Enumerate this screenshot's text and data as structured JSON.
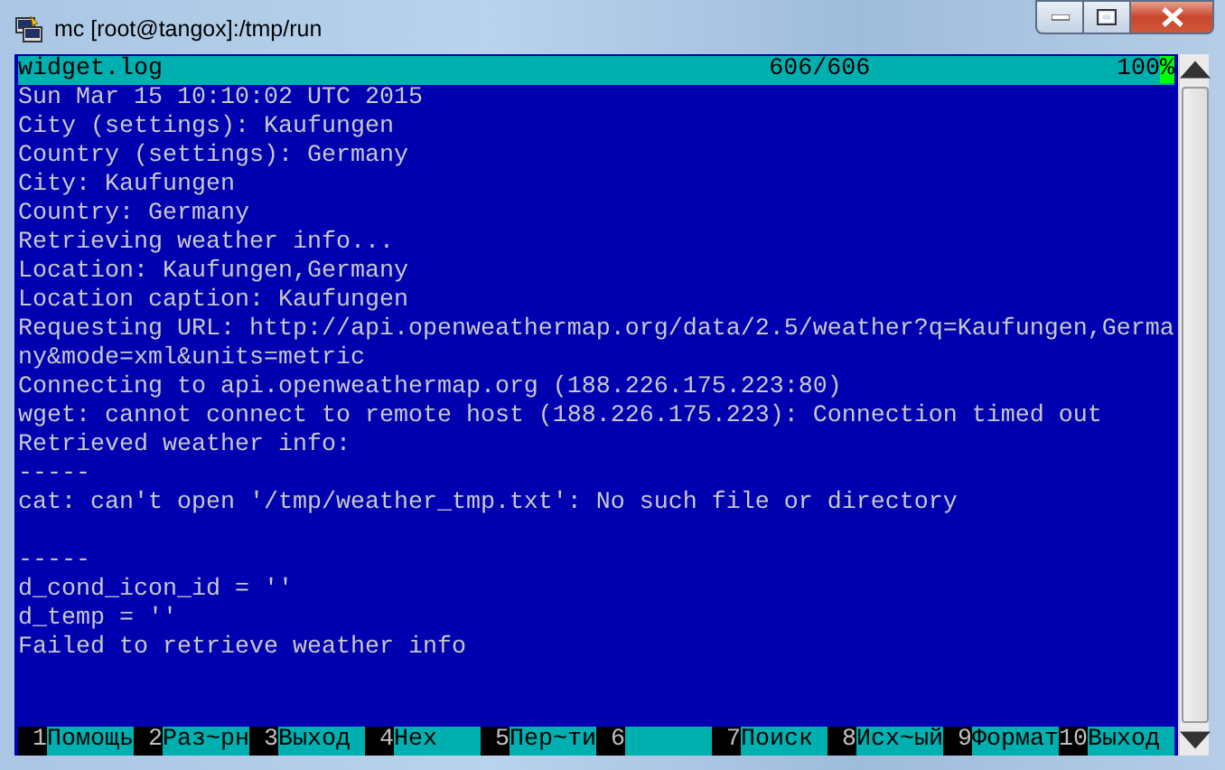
{
  "window": {
    "title": "mc [root@tangox]:/tmp/run"
  },
  "viewer": {
    "filename": "widget.log",
    "position": "606/606",
    "percent": "100%"
  },
  "log_blocks": [
    {
      "lines": [
        "Sun Mar 15 10:10:02 UTC 2015",
        "City (settings): Kaufungen",
        "Country (settings): Germany",
        "City: Kaufungen",
        "Country: Germany",
        "Retrieving weather info...",
        "Location: Kaufungen,Germany",
        "Location caption: Kaufungen",
        "Requesting URL: http://api.openweathermap.org/data/2.5/weather?q=Kaufungen,Germa",
        "ny&mode=xml&units=metric",
        "Connecting to api.openweathermap.org (188.226.175.223:80)",
        "wget: cannot connect to remote host (188.226.175.223): Connection timed out",
        "Retrieved weather info:",
        "-----",
        "cat: can't open '/tmp/weather_tmp.txt': No such file or directory"
      ]
    },
    {
      "lines": [
        "-----",
        "d_cond_icon_id = ''",
        "d_temp = ''",
        "Failed to retrieve weather info"
      ]
    }
  ],
  "function_keys": [
    {
      "number": "1",
      "label": "Помощь"
    },
    {
      "number": "2",
      "label": "Раз~рн"
    },
    {
      "number": "3",
      "label": "Выход"
    },
    {
      "number": "4",
      "label": "Hex"
    },
    {
      "number": "5",
      "label": "Пер~ти"
    },
    {
      "number": "6"
    },
    {
      "number": "7",
      "label": "Поиск"
    },
    {
      "number": "8",
      "label": "Исх~ый"
    },
    {
      "number": "9",
      "label": "Формат"
    },
    {
      "number": "10",
      "label": "Выход"
    }
  ]
}
